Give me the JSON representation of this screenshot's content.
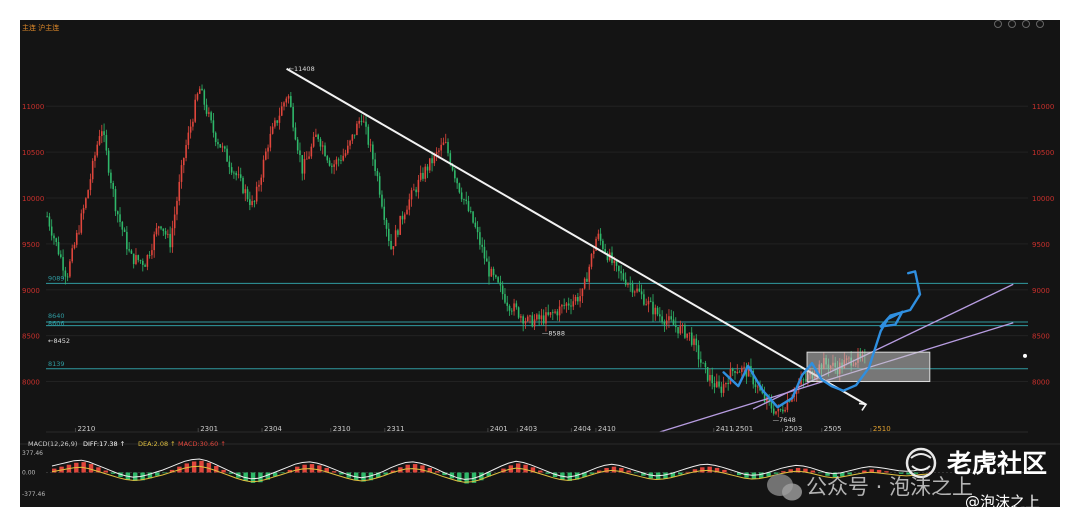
{
  "header": {
    "symbol": "主连 沪主连",
    "icons": [
      "fullscreen-icon",
      "settings-icon",
      "camera-icon",
      "close-icon"
    ]
  },
  "chart_data": {
    "type": "candlestick",
    "y_ticks": [
      8000,
      8500,
      9000,
      9500,
      10000,
      10500,
      11000
    ],
    "ylim": [
      7450,
      11700
    ],
    "x_tick_labels": [
      "2210",
      "2301",
      "2304",
      "2310",
      "2311",
      "2401",
      "2403",
      "2404",
      "2410",
      "2411",
      "2501",
      "2503",
      "2505",
      "2510"
    ],
    "annotations": {
      "high": "←11408",
      "low_mid": "—8588",
      "low_right": "—7648",
      "left_low": "←8452",
      "left_level_a": "9089",
      "left_level_b": "8640",
      "left_level_c": "8606",
      "left_level_d": "8139"
    },
    "horizontal_levels": [
      9069,
      8649,
      8609,
      8139
    ],
    "price_path": [
      [
        0,
        9800
      ],
      [
        0.02,
        9150
      ],
      [
        0.04,
        10000
      ],
      [
        0.055,
        10800
      ],
      [
        0.07,
        9900
      ],
      [
        0.085,
        9350
      ],
      [
        0.1,
        9300
      ],
      [
        0.115,
        9750
      ],
      [
        0.125,
        9500
      ],
      [
        0.14,
        10500
      ],
      [
        0.155,
        11200
      ],
      [
        0.17,
        10700
      ],
      [
        0.19,
        10300
      ],
      [
        0.21,
        9900
      ],
      [
        0.225,
        10600
      ],
      [
        0.245,
        11150
      ],
      [
        0.26,
        10300
      ],
      [
        0.275,
        10700
      ],
      [
        0.29,
        10350
      ],
      [
        0.305,
        10500
      ],
      [
        0.32,
        10900
      ],
      [
        0.335,
        10300
      ],
      [
        0.35,
        9450
      ],
      [
        0.365,
        9900
      ],
      [
        0.385,
        10300
      ],
      [
        0.405,
        10600
      ],
      [
        0.42,
        10100
      ],
      [
        0.435,
        9700
      ],
      [
        0.45,
        9200
      ],
      [
        0.47,
        8850
      ],
      [
        0.49,
        8650
      ],
      [
        0.51,
        8700
      ],
      [
        0.53,
        8850
      ],
      [
        0.545,
        8950
      ],
      [
        0.56,
        9600
      ],
      [
        0.58,
        9200
      ],
      [
        0.6,
        9000
      ],
      [
        0.62,
        8750
      ],
      [
        0.64,
        8600
      ],
      [
        0.655,
        8500
      ],
      [
        0.67,
        8100
      ],
      [
        0.685,
        7900
      ],
      [
        0.7,
        8150
      ],
      [
        0.715,
        8100
      ],
      [
        0.73,
        7800
      ],
      [
        0.745,
        7650
      ],
      [
        0.76,
        7900
      ],
      [
        0.775,
        8050
      ],
      [
        0.79,
        8200
      ],
      [
        0.805,
        8150
      ],
      [
        0.82,
        8250
      ],
      [
        0.835,
        8220
      ]
    ],
    "trendline": {
      "from": [
        0.245,
        11408
      ],
      "to": [
        0.835,
        7750
      ]
    },
    "channel": [
      {
        "from": [
          0.625,
          7450
        ],
        "to": [
          0.985,
          8640
        ]
      },
      {
        "from": [
          0.72,
          7700
        ],
        "to": [
          0.985,
          9060
        ]
      }
    ],
    "box": {
      "x0": 0.775,
      "x1": 0.9,
      "y0": 8000,
      "y1": 8320
    },
    "macd": {
      "label": "MACD(12,26,9)",
      "diff": "DIFF:17.38 ↑",
      "dea": "DEA:2.08 ↑",
      "macd": "MACD:30.60 ↑",
      "y_ticks": [
        "377.46",
        "0.00",
        "-377.46"
      ],
      "ylim": [
        -377.46,
        377.46
      ],
      "histogram": [
        60,
        90,
        120,
        150,
        160,
        130,
        80,
        30,
        -20,
        -70,
        -110,
        -130,
        -120,
        -90,
        -50,
        -10,
        40,
        90,
        140,
        170,
        180,
        150,
        100,
        40,
        -20,
        -80,
        -130,
        -160,
        -150,
        -110,
        -60,
        -10,
        40,
        90,
        120,
        130,
        110,
        70,
        20,
        -30,
        -80,
        -120,
        -140,
        -120,
        -80,
        -30,
        30,
        80,
        120,
        130,
        110,
        70,
        20,
        -40,
        -90,
        -140,
        -170,
        -160,
        -120,
        -60,
        0,
        60,
        110,
        140,
        120,
        80,
        30,
        -20,
        -70,
        -110,
        -130,
        -110,
        -70,
        -20,
        30,
        70,
        90,
        70,
        30,
        -10,
        -50,
        -90,
        -110,
        -100,
        -70,
        -30,
        10,
        50,
        80,
        90,
        70,
        40,
        0,
        -40,
        -80,
        -100,
        -90,
        -60,
        -20,
        20,
        50,
        70,
        60,
        30,
        -10,
        -50,
        -70,
        -60,
        -30,
        0,
        30,
        50,
        40,
        20,
        0,
        -20,
        -30,
        -20,
        0,
        10
      ]
    }
  },
  "watermark": {
    "brand": "老虎社区",
    "account": "公众号 · 泡沫之上",
    "handle": "@泡沫之上"
  }
}
